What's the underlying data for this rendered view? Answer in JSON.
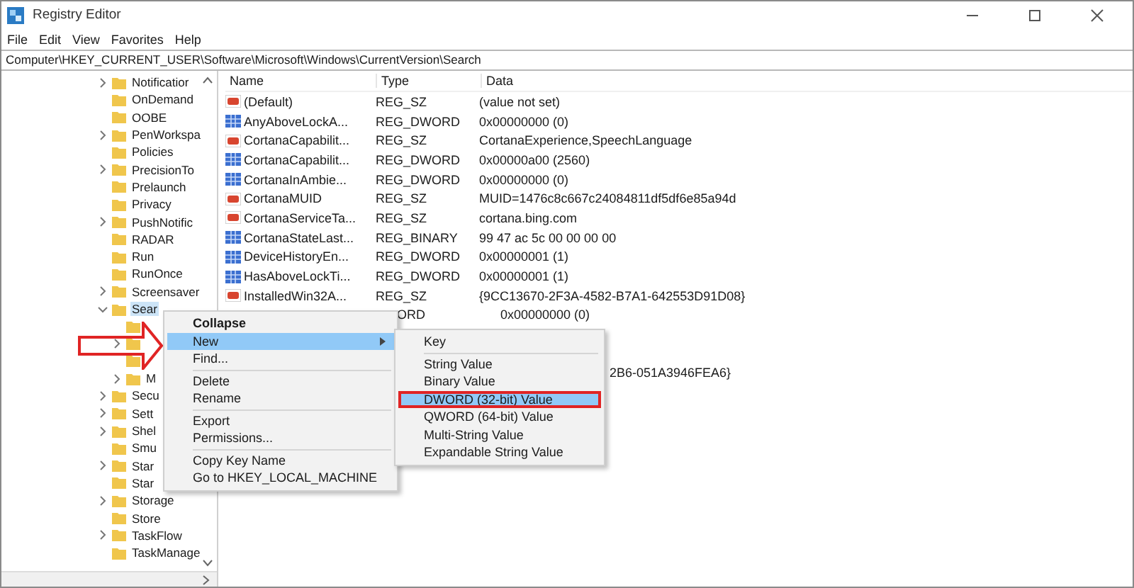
{
  "window": {
    "title": "Registry Editor"
  },
  "menu_bar": [
    "File",
    "Edit",
    "View",
    "Favorites",
    "Help"
  ],
  "address": "Computer\\HKEY_CURRENT_USER\\Software\\Microsoft\\Windows\\CurrentVersion\\Search",
  "tree": [
    {
      "label": "Notificatior",
      "expandable": true
    },
    {
      "label": "OnDemand",
      "expandable": false
    },
    {
      "label": "OOBE",
      "expandable": false
    },
    {
      "label": "PenWorkspa",
      "expandable": true
    },
    {
      "label": "Policies",
      "expandable": false
    },
    {
      "label": "PrecisionTo",
      "expandable": true
    },
    {
      "label": "Prelaunch",
      "expandable": false
    },
    {
      "label": "Privacy",
      "expandable": false
    },
    {
      "label": "PushNotific",
      "expandable": true
    },
    {
      "label": "RADAR",
      "expandable": false
    },
    {
      "label": "Run",
      "expandable": false
    },
    {
      "label": "RunOnce",
      "expandable": false
    },
    {
      "label": "Screensaver",
      "expandable": true
    },
    {
      "label": "Sear",
      "expandable": true,
      "expanded": true,
      "selected": true,
      "children": [
        {
          "expandable": false
        },
        {
          "expandable": true
        },
        {
          "expandable": false
        },
        {
          "label": "M",
          "expandable": true
        }
      ]
    },
    {
      "label": "Secu",
      "expandable": true
    },
    {
      "label": "Sett",
      "expandable": true
    },
    {
      "label": "Shel",
      "expandable": true
    },
    {
      "label": "Smu",
      "expandable": false
    },
    {
      "label": "Star",
      "expandable": true
    },
    {
      "label": "Star",
      "expandable": false
    },
    {
      "label": "Storage",
      "expandable": true
    },
    {
      "label": "Store",
      "expandable": false
    },
    {
      "label": "TaskFlow",
      "expandable": true
    },
    {
      "label": "TaskManage",
      "expandable": false
    }
  ],
  "table": {
    "columns": [
      "Name",
      "Type",
      "Data"
    ],
    "rows": [
      {
        "kind": "string",
        "name": "(Default)",
        "type": "REG_SZ",
        "data": "(value not set)"
      },
      {
        "kind": "binary",
        "name": "AnyAboveLockA...",
        "type": "REG_DWORD",
        "data": "0x00000000 (0)"
      },
      {
        "kind": "string",
        "name": "CortanaCapabilit...",
        "type": "REG_SZ",
        "data": "CortanaExperience,SpeechLanguage"
      },
      {
        "kind": "binary",
        "name": "CortanaCapabilit...",
        "type": "REG_DWORD",
        "data": "0x00000a00 (2560)"
      },
      {
        "kind": "binary",
        "name": "CortanaInAmbie...",
        "type": "REG_DWORD",
        "data": "0x00000000 (0)"
      },
      {
        "kind": "string",
        "name": "CortanaMUID",
        "type": "REG_SZ",
        "data": "MUID=1476c8c667c24084811df5df6e85a94d"
      },
      {
        "kind": "string",
        "name": "CortanaServiceTa...",
        "type": "REG_SZ",
        "data": "cortana.bing.com"
      },
      {
        "kind": "binary",
        "name": "CortanaStateLast...",
        "type": "REG_BINARY",
        "data": "99 47 ac 5c 00 00 00 00"
      },
      {
        "kind": "binary",
        "name": "DeviceHistoryEn...",
        "type": "REG_DWORD",
        "data": "0x00000001 (1)"
      },
      {
        "kind": "binary",
        "name": "HasAboveLockTi...",
        "type": "REG_DWORD",
        "data": "0x00000001 (1)"
      },
      {
        "kind": "string",
        "name": "InstalledWin32A...",
        "type": "REG_SZ",
        "data": "{9CC13670-2F3A-4582-B7A1-642553D91D08}"
      },
      {
        "kind": "covered",
        "type": "ORD",
        "data": "0x00000000 (0)"
      },
      {
        "kind": "fragment",
        "data": "2B6-051A3946FEA6}"
      }
    ]
  },
  "context_menu": [
    {
      "kind": "item",
      "label": "Collapse",
      "bold": true,
      "selected": false
    },
    {
      "kind": "item",
      "label": "New",
      "submenu": true,
      "selected": true
    },
    {
      "kind": "item",
      "label": "Find...",
      "selected": false
    },
    {
      "kind": "separator"
    },
    {
      "kind": "item",
      "label": "Delete",
      "selected": false
    },
    {
      "kind": "item",
      "label": "Rename",
      "selected": false
    },
    {
      "kind": "separator"
    },
    {
      "kind": "item",
      "label": "Export",
      "selected": false
    },
    {
      "kind": "item",
      "label": "Permissions...",
      "selected": false
    },
    {
      "kind": "separator"
    },
    {
      "kind": "item",
      "label": "Copy Key Name",
      "selected": false
    },
    {
      "kind": "item",
      "label": "Go to HKEY_LOCAL_MACHINE",
      "selected": false
    }
  ],
  "submenu": [
    {
      "kind": "item",
      "label": "Key",
      "selected": false
    },
    {
      "kind": "separator"
    },
    {
      "kind": "item",
      "label": "String Value",
      "selected": false
    },
    {
      "kind": "item",
      "label": "Binary Value",
      "selected": false
    },
    {
      "kind": "item",
      "label": "DWORD (32-bit) Value",
      "selected": true,
      "outlined": true
    },
    {
      "kind": "item",
      "label": "QWORD (64-bit) Value",
      "selected": false
    },
    {
      "kind": "item",
      "label": "Multi-String Value",
      "selected": false
    },
    {
      "kind": "item",
      "label": "Expandable String Value",
      "selected": false
    }
  ]
}
